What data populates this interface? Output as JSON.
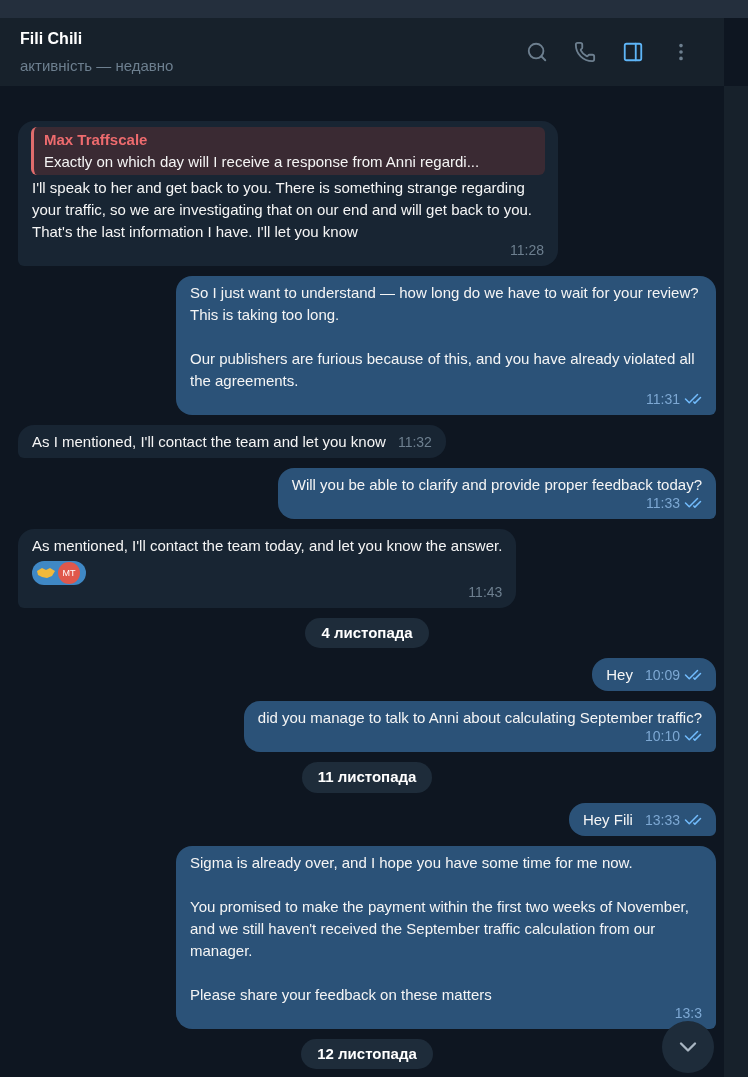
{
  "header": {
    "title": "Fili Chili",
    "status": "активність — недавно"
  },
  "messages": [
    {
      "kind": "incoming",
      "reply": {
        "author": "Max Traffscale",
        "text": "Exactly on which day will I receive a response from Anni regardi..."
      },
      "paragraphs": [
        "I'll speak to her and get back to you. There is something strange regarding your traffic, so we are investigating that on our end and will get back to you. That's the last information I have. I'll let you know"
      ],
      "time": "11:28"
    },
    {
      "kind": "outgoing",
      "paragraphs": [
        "So I just want to understand — how long do we have to wait for your review? This is taking too long.",
        "Our publishers are furious because of this, and you have already violated all the agreements."
      ],
      "time": "11:31",
      "read": true
    },
    {
      "kind": "incoming",
      "paragraphs": [
        "As I mentioned, I'll contact the team and let you know"
      ],
      "time": "11:32"
    },
    {
      "kind": "outgoing",
      "paragraphs": [
        "Will you be able to clarify and provide proper feedback today?"
      ],
      "time": "11:33",
      "read": true
    },
    {
      "kind": "incoming",
      "paragraphs": [
        "As mentioned, I'll contact the team today, and let you know the answer."
      ],
      "reaction": {
        "avatar": "MT"
      },
      "time": "11:43"
    },
    {
      "kind": "date",
      "text": "4 листопада"
    },
    {
      "kind": "outgoing",
      "paragraphs": [
        "Hey"
      ],
      "time": "10:09",
      "read": true
    },
    {
      "kind": "outgoing",
      "paragraphs": [
        "did you manage to talk to Anni about calculating September traffic?"
      ],
      "time": "10:10",
      "read": true
    },
    {
      "kind": "date",
      "text": "11 листопада"
    },
    {
      "kind": "outgoing",
      "paragraphs": [
        "Hey Fili"
      ],
      "time": "13:33",
      "read": true
    },
    {
      "kind": "outgoing",
      "paragraphs": [
        "Sigma is already over, and I hope you have some time for me now.",
        "You promised to make the payment within the first two weeks of November, and we still haven't received the September traffic calculation from our manager.",
        "Please share your feedback on these matters"
      ],
      "time": "13:3"
    },
    {
      "kind": "date",
      "text": "12 листопада"
    }
  ]
}
